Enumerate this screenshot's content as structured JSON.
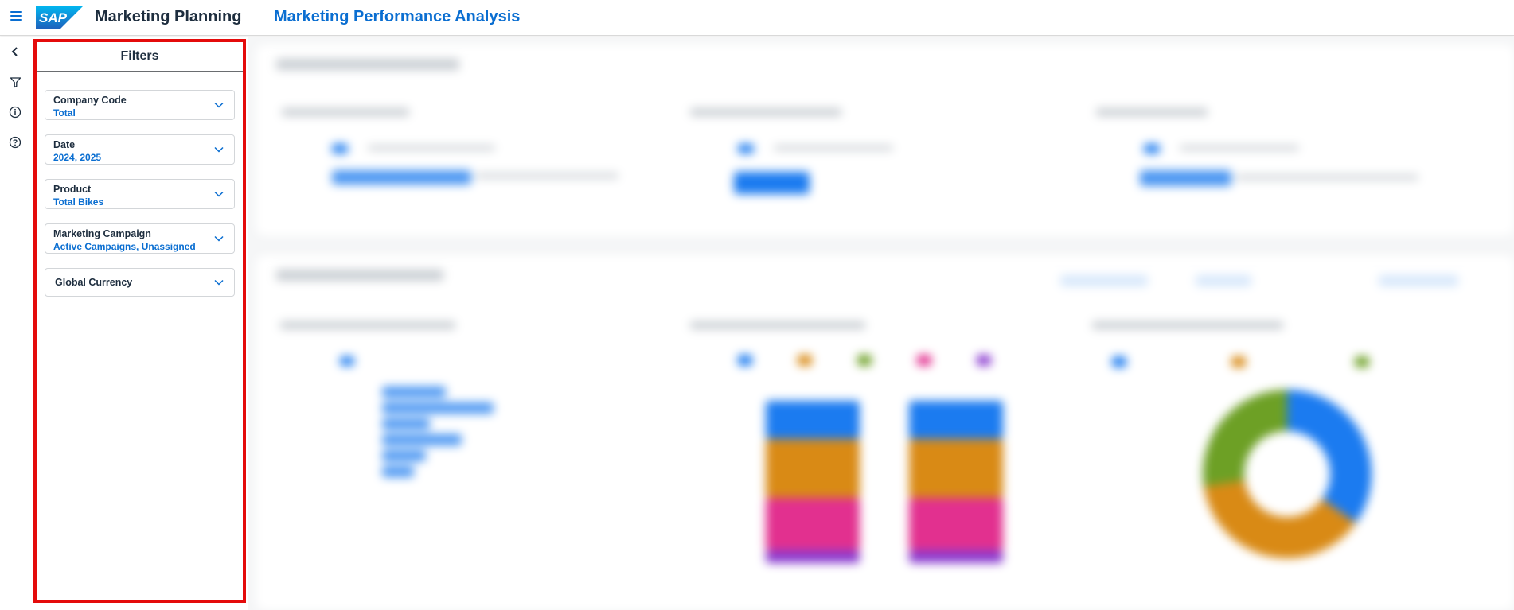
{
  "shell": {
    "logo_text": "SAP",
    "app_title": "Marketing Planning",
    "page_title": "Marketing Performance Analysis",
    "menu_icon": "hamburger-menu-icon"
  },
  "rail": {
    "items": [
      {
        "icon": "chevron-left-icon"
      },
      {
        "icon": "filter-icon"
      },
      {
        "icon": "info-icon"
      },
      {
        "icon": "help-icon"
      }
    ]
  },
  "filters": {
    "title": "Filters",
    "items": [
      {
        "label": "Company Code",
        "value": "Total"
      },
      {
        "label": "Date",
        "value": "2024, 2025"
      },
      {
        "label": "Product",
        "value": "Total Bikes"
      },
      {
        "label": "Marketing Campaign",
        "value": "Active Campaigns, Unassigned"
      },
      {
        "label": "Global Currency",
        "value": ""
      }
    ]
  },
  "colors": {
    "brand_blue": "#0a6ed1",
    "highlight_border": "#e40b0b",
    "chart_blue": "#1b7bf0",
    "chart_orange": "#d98a15",
    "chart_pink": "#e2308f",
    "chart_purple": "#8a3bd0",
    "chart_green": "#6da025"
  }
}
